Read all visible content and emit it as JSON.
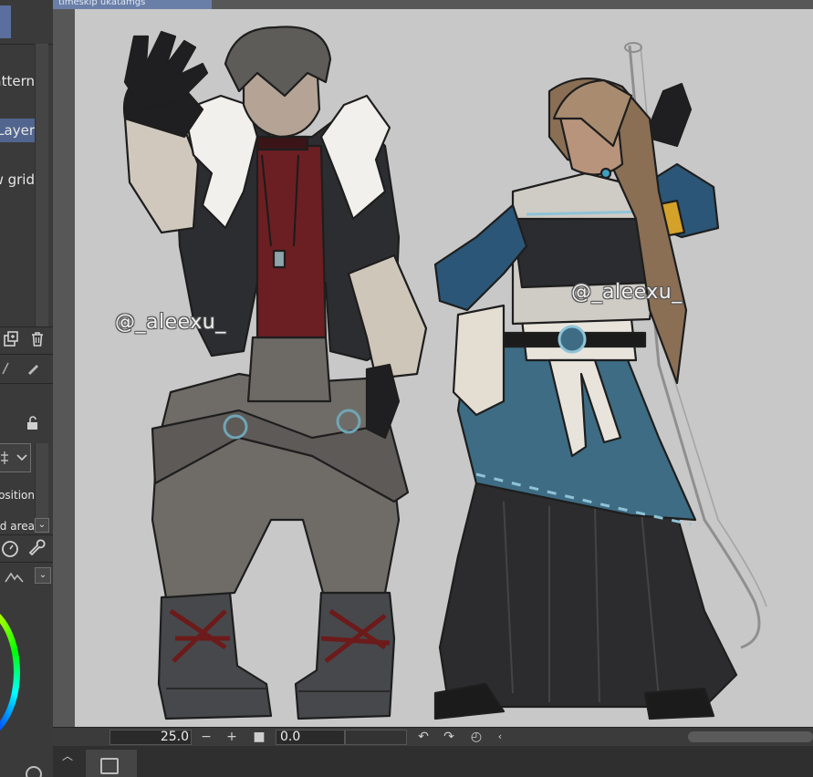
{
  "document": {
    "tab_title": "timeskip ukatamgs"
  },
  "left_panel": {
    "items": [
      {
        "label": "Pattern",
        "selected": false
      },
      {
        "label": "Layer",
        "selected": true
      },
      {
        "label": "Show grid",
        "selected": false
      }
    ],
    "option_fixed": "Fixed position",
    "option_area": "Fixed area"
  },
  "canvas": {
    "watermark_left": "@_aleexu_",
    "watermark_right": "@_aleexu_",
    "paper_color": "#c8c8c8"
  },
  "statusbar": {
    "zoom": "25.0",
    "rotation": "0.0"
  },
  "icons": {
    "new_layer": "new-layer-icon",
    "delete": "trash-icon",
    "lock": "lock-icon",
    "zoom_out": "minus-icon",
    "zoom_in": "plus-icon",
    "fit": "square-icon",
    "rotate_left": "rotate-left-icon",
    "rotate_right": "rotate-right-icon",
    "reset_rotation": "reset-rotation-icon"
  },
  "colors": {
    "accent": "#51658e",
    "panel": "#3a3a3a",
    "canvas_bg": "#575757"
  }
}
